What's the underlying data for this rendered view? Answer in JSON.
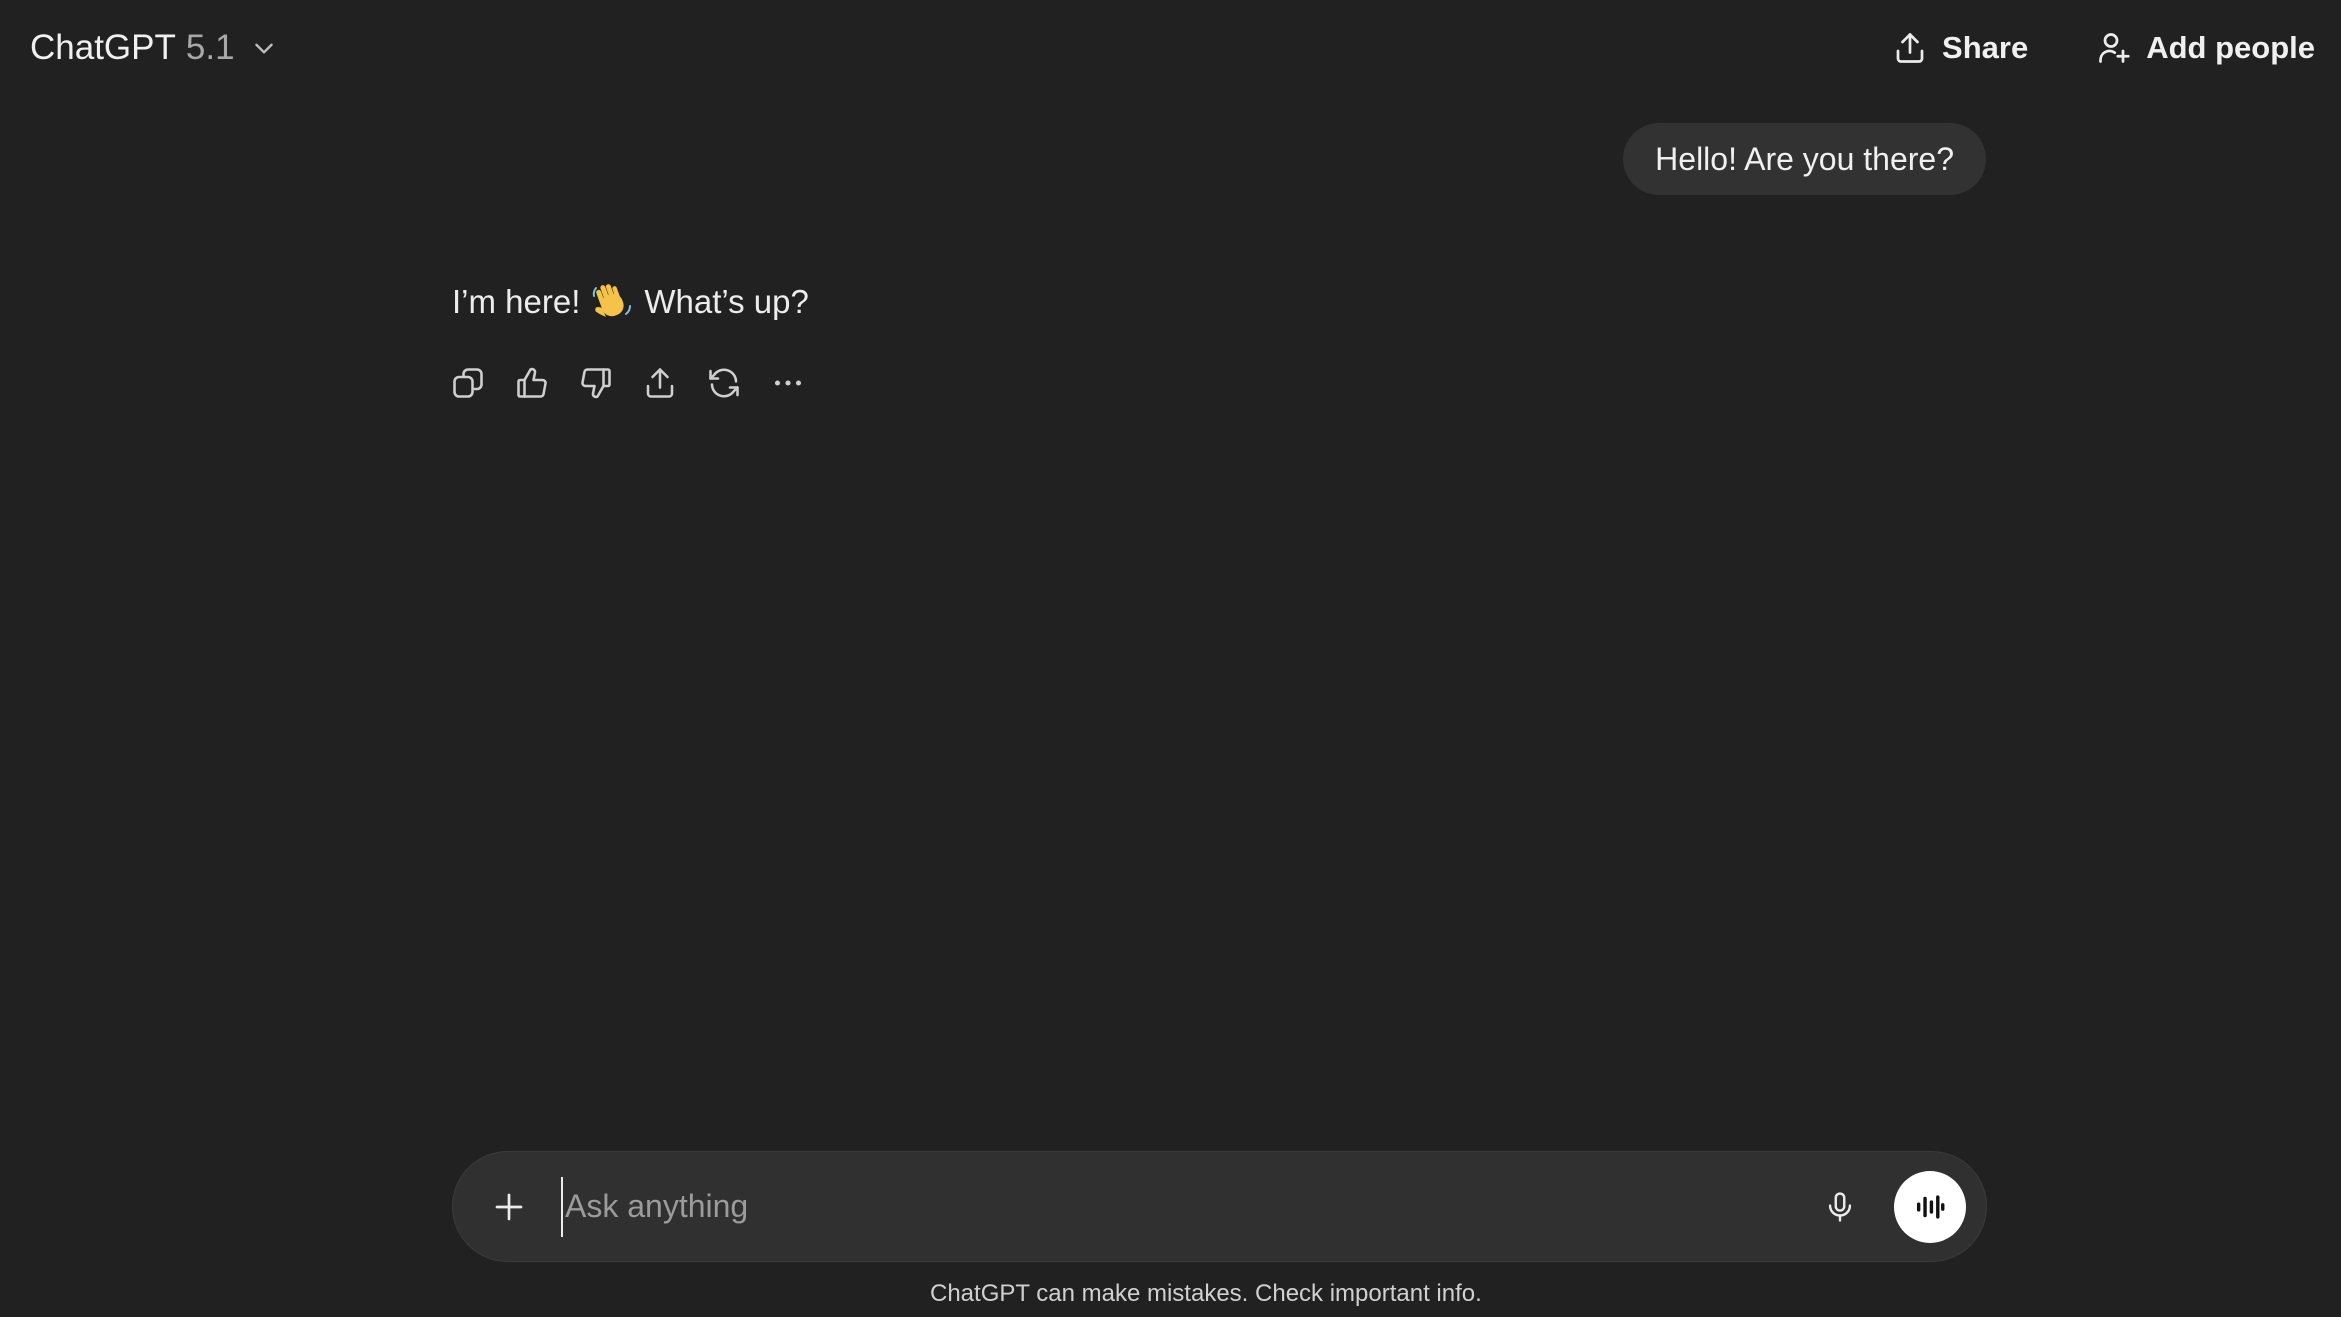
{
  "header": {
    "model_name": "ChatGPT",
    "model_version": "5.1",
    "share_label": "Share",
    "add_people_label": "Add people"
  },
  "conversation": {
    "user_message": "Hello! Are you there?",
    "assistant_text_before": "I’m here!",
    "assistant_emoji": "👋",
    "assistant_text_after": "What’s up?",
    "actions": [
      "copy-icon",
      "thumbs-up-icon",
      "thumbs-down-icon",
      "share-icon",
      "regenerate-icon",
      "more-icon"
    ]
  },
  "composer": {
    "placeholder": "Ask anything",
    "value": ""
  },
  "footer": {
    "disclaimer": "ChatGPT can make mistakes. Check important info."
  },
  "colors": {
    "background": "#212121",
    "bubble": "#323232",
    "composer": "#303030",
    "text": "#ececec"
  }
}
